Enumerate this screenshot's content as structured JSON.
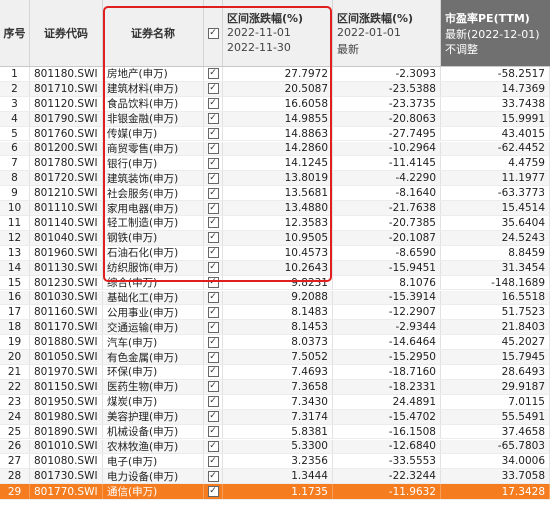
{
  "headers": {
    "idx": "序号",
    "code": "证券代码",
    "name": "证券名称",
    "check": "✓",
    "chg1": {
      "title": "区间涨跌幅(%)",
      "line2": "2022-11-01",
      "line3": "2022-11-30"
    },
    "chg2": {
      "title": "区间涨跌幅(%)",
      "line2": "2022-01-01",
      "line3": "最新"
    },
    "pe": {
      "title": "市盈率PE(TTM)",
      "line2": "最新(2022-12-01)",
      "line3": "不调整"
    }
  },
  "rows": [
    {
      "idx": "1",
      "code": "801180.SWI",
      "name": "房地产(申万)",
      "chg1": "27.7972",
      "chg2": "-2.3093",
      "pe": "-58.2517"
    },
    {
      "idx": "2",
      "code": "801710.SWI",
      "name": "建筑材料(申万)",
      "chg1": "20.5087",
      "chg2": "-23.5388",
      "pe": "14.7369"
    },
    {
      "idx": "3",
      "code": "801120.SWI",
      "name": "食品饮料(申万)",
      "chg1": "16.6058",
      "chg2": "-23.3735",
      "pe": "33.7438"
    },
    {
      "idx": "4",
      "code": "801790.SWI",
      "name": "非银金融(申万)",
      "chg1": "14.9855",
      "chg2": "-20.8063",
      "pe": "15.9991"
    },
    {
      "idx": "5",
      "code": "801760.SWI",
      "name": "传媒(申万)",
      "chg1": "14.8863",
      "chg2": "-27.7495",
      "pe": "43.4015"
    },
    {
      "idx": "6",
      "code": "801200.SWI",
      "name": "商贸零售(申万)",
      "chg1": "14.2860",
      "chg2": "-10.2964",
      "pe": "-62.4452"
    },
    {
      "idx": "7",
      "code": "801780.SWI",
      "name": "银行(申万)",
      "chg1": "14.1245",
      "chg2": "-11.4145",
      "pe": "4.4759"
    },
    {
      "idx": "8",
      "code": "801720.SWI",
      "name": "建筑装饰(申万)",
      "chg1": "13.8019",
      "chg2": "-4.2290",
      "pe": "11.1977"
    },
    {
      "idx": "9",
      "code": "801210.SWI",
      "name": "社会服务(申万)",
      "chg1": "13.5681",
      "chg2": "-8.1640",
      "pe": "-63.3773"
    },
    {
      "idx": "10",
      "code": "801110.SWI",
      "name": "家用电器(申万)",
      "chg1": "13.4880",
      "chg2": "-21.7638",
      "pe": "15.4514"
    },
    {
      "idx": "11",
      "code": "801140.SWI",
      "name": "轻工制造(申万)",
      "chg1": "12.3583",
      "chg2": "-20.7385",
      "pe": "35.6404"
    },
    {
      "idx": "12",
      "code": "801040.SWI",
      "name": "钢铁(申万)",
      "chg1": "10.9505",
      "chg2": "-20.1087",
      "pe": "24.5243"
    },
    {
      "idx": "13",
      "code": "801960.SWI",
      "name": "石油石化(申万)",
      "chg1": "10.4573",
      "chg2": "-8.6590",
      "pe": "8.8459"
    },
    {
      "idx": "14",
      "code": "801130.SWI",
      "name": "纺织服饰(申万)",
      "chg1": "10.2643",
      "chg2": "-15.9451",
      "pe": "31.3454"
    },
    {
      "idx": "15",
      "code": "801230.SWI",
      "name": "综合(申万)",
      "chg1": "9.8231",
      "chg2": "8.1076",
      "pe": "-148.1689"
    },
    {
      "idx": "16",
      "code": "801030.SWI",
      "name": "基础化工(申万)",
      "chg1": "9.2088",
      "chg2": "-15.3914",
      "pe": "16.5518"
    },
    {
      "idx": "17",
      "code": "801160.SWI",
      "name": "公用事业(申万)",
      "chg1": "8.1483",
      "chg2": "-12.2907",
      "pe": "51.7523"
    },
    {
      "idx": "18",
      "code": "801170.SWI",
      "name": "交通运输(申万)",
      "chg1": "8.1453",
      "chg2": "-2.9344",
      "pe": "21.8403"
    },
    {
      "idx": "19",
      "code": "801880.SWI",
      "name": "汽车(申万)",
      "chg1": "8.0373",
      "chg2": "-14.6464",
      "pe": "45.2027"
    },
    {
      "idx": "20",
      "code": "801050.SWI",
      "name": "有色金属(申万)",
      "chg1": "7.5052",
      "chg2": "-15.2950",
      "pe": "15.7945"
    },
    {
      "idx": "21",
      "code": "801970.SWI",
      "name": "环保(申万)",
      "chg1": "7.4693",
      "chg2": "-18.7160",
      "pe": "28.6493"
    },
    {
      "idx": "22",
      "code": "801150.SWI",
      "name": "医药生物(申万)",
      "chg1": "7.3658",
      "chg2": "-18.2331",
      "pe": "29.9187"
    },
    {
      "idx": "23",
      "code": "801950.SWI",
      "name": "煤炭(申万)",
      "chg1": "7.3430",
      "chg2": "24.4891",
      "pe": "7.0115"
    },
    {
      "idx": "24",
      "code": "801980.SWI",
      "name": "美容护理(申万)",
      "chg1": "7.3174",
      "chg2": "-15.4702",
      "pe": "55.5491"
    },
    {
      "idx": "25",
      "code": "801890.SWI",
      "name": "机械设备(申万)",
      "chg1": "5.8381",
      "chg2": "-16.1508",
      "pe": "37.4658"
    },
    {
      "idx": "26",
      "code": "801010.SWI",
      "name": "农林牧渔(申万)",
      "chg1": "5.3300",
      "chg2": "-12.6840",
      "pe": "-65.7803"
    },
    {
      "idx": "27",
      "code": "801080.SWI",
      "name": "电子(申万)",
      "chg1": "3.2356",
      "chg2": "-33.5553",
      "pe": "34.0006"
    },
    {
      "idx": "28",
      "code": "801730.SWI",
      "name": "电力设备(申万)",
      "chg1": "1.3444",
      "chg2": "-22.3244",
      "pe": "33.7058"
    },
    {
      "idx": "29",
      "code": "801770.SWI",
      "name": "通信(申万)",
      "chg1": "1.1735",
      "chg2": "-11.9632",
      "pe": "17.3428",
      "selected": true
    }
  ],
  "colors": {
    "accent": "#f57c1f",
    "pe_header": "#707070",
    "highlight_box": "#e02020"
  }
}
